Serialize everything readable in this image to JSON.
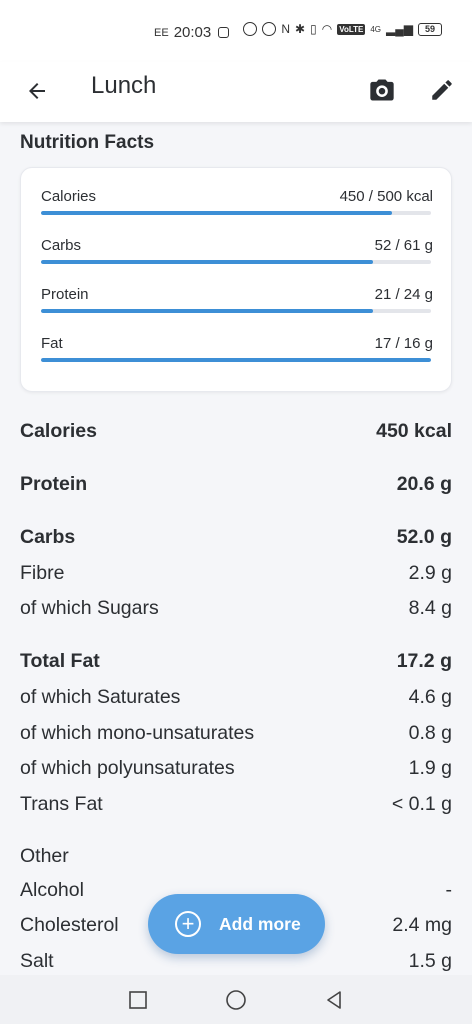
{
  "status_bar": {
    "carrier": "EE",
    "time": "20:03",
    "volte": "VoLTE",
    "network": "4G",
    "battery": "59"
  },
  "app_bar": {
    "title": "Lunch",
    "icons": [
      "arrow-back-icon",
      "camera-icon",
      "edit-pencil-icon"
    ]
  },
  "nutrition_facts": {
    "heading": "Nutrition Facts",
    "progress": [
      {
        "label": "Calories",
        "value_text": "450 / 500 kcal",
        "fraction": 0.9
      },
      {
        "label": "Carbs",
        "value_text": "52 / 61 g",
        "fraction": 0.852
      },
      {
        "label": "Protein",
        "value_text": "21 / 24 g",
        "fraction": 0.85
      },
      {
        "label": "Fat",
        "value_text": "17 / 16 g",
        "fraction": 1.0
      }
    ],
    "accent_color": "#3d8fd6"
  },
  "details": [
    {
      "label": "Calories",
      "value": "450 kcal"
    },
    {
      "label": "Protein",
      "value": "20.6 g"
    },
    {
      "label": "Carbs",
      "value": "52.0 g"
    },
    {
      "label": "Fibre",
      "value": "2.9 g"
    },
    {
      "label": "of which Sugars",
      "value": "8.4 g"
    },
    {
      "label": "Total Fat",
      "value": "17.2 g"
    },
    {
      "label": "of which Saturates",
      "value": "4.6 g"
    },
    {
      "label": "of which mono-unsaturates",
      "value": "0.8 g"
    },
    {
      "label": "of which polyunsaturates",
      "value": "1.9 g"
    },
    {
      "label": "Trans Fat",
      "value": "< 0.1 g"
    },
    {
      "label": "Other",
      "value": ""
    },
    {
      "label": "Alcohol",
      "value": "-"
    },
    {
      "label": "Cholesterol",
      "value": "2.4 mg"
    },
    {
      "label": "Salt",
      "value": "1.5 g"
    }
  ],
  "fab": {
    "label": "Add more",
    "color": "#5aa3e4"
  },
  "nav_bar": {
    "icons": [
      "recent-apps-icon",
      "home-icon",
      "back-triangle-icon"
    ]
  }
}
